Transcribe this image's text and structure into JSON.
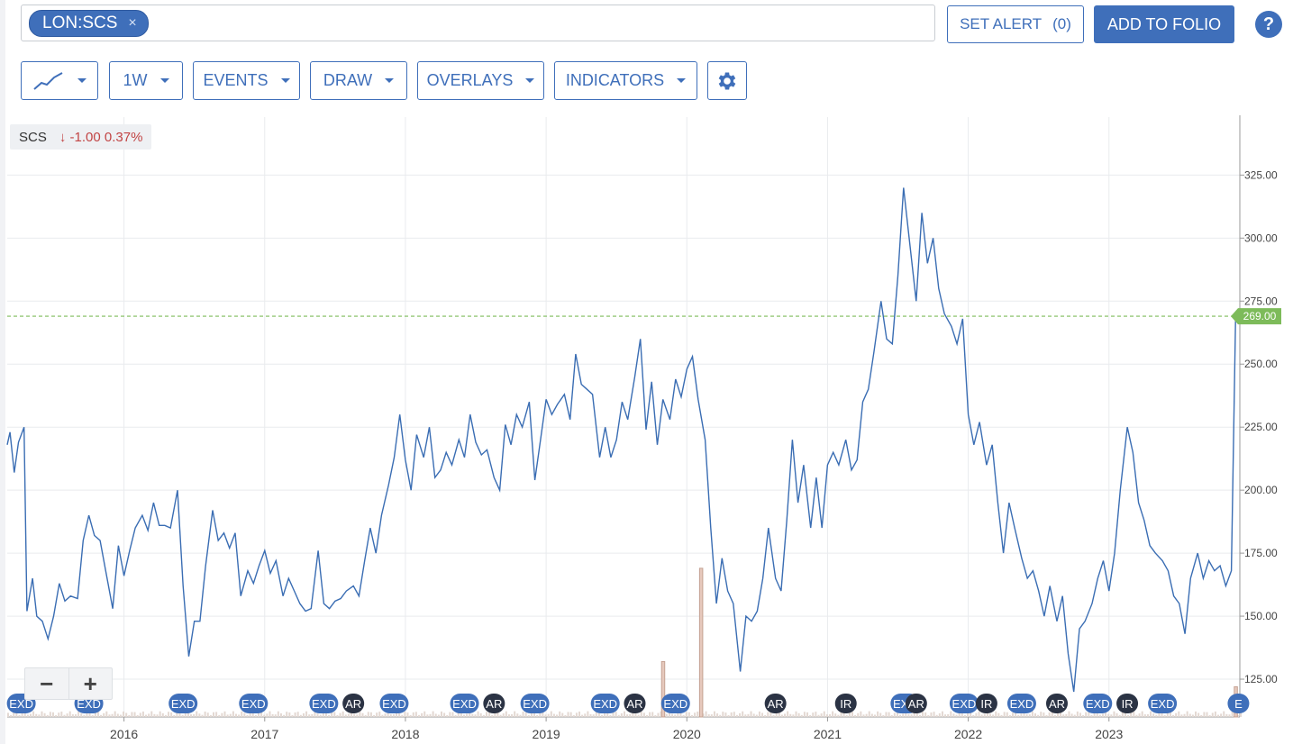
{
  "search": {
    "chip_label": "LON:SCS",
    "chip_close": "×"
  },
  "header": {
    "set_alert_label": "SET ALERT",
    "set_alert_count": "(0)",
    "add_to_folio_label": "ADD TO FOLIO",
    "help_label": "?"
  },
  "toolbar": {
    "period_label": "1W",
    "events_label": "EVENTS",
    "draw_label": "DRAW",
    "overlays_label": "OVERLAYS",
    "indicators_label": "INDICATORS"
  },
  "legend": {
    "symbol": "SCS",
    "arrow": "↓",
    "change": "-1.00 0.37%"
  },
  "zoom": {
    "minus": "−",
    "plus": "+"
  },
  "colors": {
    "accent": "#3f6fba",
    "line": "#3a6db3",
    "last_price": "#7dbb5a",
    "negative": "#c24545"
  },
  "chart_data": {
    "type": "line",
    "series_name": "SCS",
    "interval": "1W",
    "y_ticks": [
      125,
      150,
      175,
      200,
      225,
      250,
      275,
      300,
      325
    ],
    "y_tick_labels": [
      "125.00",
      "150.00",
      "175.00",
      "200.00",
      "225.00",
      "250.00",
      "275.00",
      "300.00",
      "325.00"
    ],
    "ylim": [
      110,
      348
    ],
    "xlim": [
      2015.17,
      2023.93
    ],
    "x_ticks": [
      2016,
      2017,
      2018,
      2019,
      2020,
      2021,
      2022,
      2023
    ],
    "x_tick_labels": [
      "2016",
      "2017",
      "2018",
      "2019",
      "2020",
      "2021",
      "2022",
      "2023"
    ],
    "last_price": 269.0,
    "last_price_label": "269.00",
    "points": [
      [
        2015.17,
        218
      ],
      [
        2015.19,
        223
      ],
      [
        2015.22,
        207
      ],
      [
        2015.25,
        219
      ],
      [
        2015.29,
        225
      ],
      [
        2015.31,
        152
      ],
      [
        2015.35,
        165
      ],
      [
        2015.38,
        150
      ],
      [
        2015.42,
        148
      ],
      [
        2015.46,
        141
      ],
      [
        2015.5,
        150
      ],
      [
        2015.54,
        163
      ],
      [
        2015.58,
        156
      ],
      [
        2015.62,
        158
      ],
      [
        2015.67,
        157
      ],
      [
        2015.71,
        180
      ],
      [
        2015.75,
        190
      ],
      [
        2015.79,
        182
      ],
      [
        2015.83,
        180
      ],
      [
        2015.87,
        168
      ],
      [
        2015.92,
        153
      ],
      [
        2015.96,
        178
      ],
      [
        2016.0,
        166
      ],
      [
        2016.04,
        176
      ],
      [
        2016.08,
        185
      ],
      [
        2016.13,
        190
      ],
      [
        2016.17,
        184
      ],
      [
        2016.21,
        195
      ],
      [
        2016.25,
        186
      ],
      [
        2016.29,
        186
      ],
      [
        2016.33,
        185
      ],
      [
        2016.38,
        200
      ],
      [
        2016.42,
        162
      ],
      [
        2016.46,
        134
      ],
      [
        2016.5,
        148
      ],
      [
        2016.54,
        148
      ],
      [
        2016.58,
        170
      ],
      [
        2016.63,
        192
      ],
      [
        2016.67,
        180
      ],
      [
        2016.71,
        183
      ],
      [
        2016.75,
        177
      ],
      [
        2016.79,
        183
      ],
      [
        2016.83,
        158
      ],
      [
        2016.88,
        168
      ],
      [
        2016.92,
        163
      ],
      [
        2016.96,
        170
      ],
      [
        2017.0,
        176
      ],
      [
        2017.04,
        167
      ],
      [
        2017.08,
        172
      ],
      [
        2017.13,
        158
      ],
      [
        2017.17,
        165
      ],
      [
        2017.21,
        160
      ],
      [
        2017.25,
        155
      ],
      [
        2017.29,
        152
      ],
      [
        2017.33,
        153
      ],
      [
        2017.38,
        176
      ],
      [
        2017.42,
        155
      ],
      [
        2017.46,
        153
      ],
      [
        2017.5,
        156
      ],
      [
        2017.54,
        157
      ],
      [
        2017.58,
        160
      ],
      [
        2017.63,
        162
      ],
      [
        2017.67,
        158
      ],
      [
        2017.71,
        172
      ],
      [
        2017.75,
        185
      ],
      [
        2017.79,
        175
      ],
      [
        2017.83,
        190
      ],
      [
        2017.88,
        202
      ],
      [
        2017.92,
        213
      ],
      [
        2017.96,
        230
      ],
      [
        2018.0,
        212
      ],
      [
        2018.04,
        200
      ],
      [
        2018.08,
        222
      ],
      [
        2018.13,
        213
      ],
      [
        2018.17,
        225
      ],
      [
        2018.21,
        205
      ],
      [
        2018.25,
        208
      ],
      [
        2018.29,
        215
      ],
      [
        2018.33,
        210
      ],
      [
        2018.38,
        220
      ],
      [
        2018.42,
        213
      ],
      [
        2018.46,
        230
      ],
      [
        2018.5,
        219
      ],
      [
        2018.54,
        214
      ],
      [
        2018.58,
        216
      ],
      [
        2018.63,
        205
      ],
      [
        2018.67,
        200
      ],
      [
        2018.71,
        226
      ],
      [
        2018.75,
        218
      ],
      [
        2018.79,
        230
      ],
      [
        2018.83,
        225
      ],
      [
        2018.88,
        235
      ],
      [
        2018.92,
        204
      ],
      [
        2018.96,
        220
      ],
      [
        2019.0,
        236
      ],
      [
        2019.04,
        230
      ],
      [
        2019.08,
        234
      ],
      [
        2019.13,
        238
      ],
      [
        2019.17,
        228
      ],
      [
        2019.21,
        254
      ],
      [
        2019.25,
        242
      ],
      [
        2019.29,
        240
      ],
      [
        2019.33,
        238
      ],
      [
        2019.38,
        213
      ],
      [
        2019.42,
        225
      ],
      [
        2019.46,
        213
      ],
      [
        2019.5,
        220
      ],
      [
        2019.54,
        235
      ],
      [
        2019.58,
        228
      ],
      [
        2019.63,
        245
      ],
      [
        2019.67,
        260
      ],
      [
        2019.71,
        224
      ],
      [
        2019.75,
        243
      ],
      [
        2019.79,
        218
      ],
      [
        2019.83,
        236
      ],
      [
        2019.88,
        228
      ],
      [
        2019.92,
        244
      ],
      [
        2019.96,
        237
      ],
      [
        2020.0,
        248
      ],
      [
        2020.04,
        253
      ],
      [
        2020.08,
        236
      ],
      [
        2020.13,
        220
      ],
      [
        2020.17,
        185
      ],
      [
        2020.21,
        155
      ],
      [
        2020.25,
        173
      ],
      [
        2020.29,
        160
      ],
      [
        2020.33,
        155
      ],
      [
        2020.38,
        128
      ],
      [
        2020.42,
        150
      ],
      [
        2020.46,
        148
      ],
      [
        2020.5,
        152
      ],
      [
        2020.54,
        165
      ],
      [
        2020.58,
        185
      ],
      [
        2020.63,
        165
      ],
      [
        2020.67,
        160
      ],
      [
        2020.71,
        188
      ],
      [
        2020.75,
        220
      ],
      [
        2020.79,
        195
      ],
      [
        2020.83,
        210
      ],
      [
        2020.88,
        185
      ],
      [
        2020.92,
        205
      ],
      [
        2020.96,
        185
      ],
      [
        2021.0,
        210
      ],
      [
        2021.04,
        215
      ],
      [
        2021.08,
        210
      ],
      [
        2021.13,
        220
      ],
      [
        2021.17,
        208
      ],
      [
        2021.21,
        212
      ],
      [
        2021.25,
        235
      ],
      [
        2021.29,
        240
      ],
      [
        2021.33,
        255
      ],
      [
        2021.38,
        275
      ],
      [
        2021.42,
        260
      ],
      [
        2021.46,
        258
      ],
      [
        2021.5,
        285
      ],
      [
        2021.54,
        320
      ],
      [
        2021.58,
        300
      ],
      [
        2021.63,
        275
      ],
      [
        2021.67,
        310
      ],
      [
        2021.71,
        290
      ],
      [
        2021.75,
        300
      ],
      [
        2021.79,
        280
      ],
      [
        2021.83,
        270
      ],
      [
        2021.88,
        265
      ],
      [
        2021.92,
        258
      ],
      [
        2021.96,
        268
      ],
      [
        2022.0,
        230
      ],
      [
        2022.04,
        218
      ],
      [
        2022.08,
        227
      ],
      [
        2022.13,
        210
      ],
      [
        2022.17,
        218
      ],
      [
        2022.21,
        195
      ],
      [
        2022.25,
        175
      ],
      [
        2022.29,
        195
      ],
      [
        2022.33,
        185
      ],
      [
        2022.38,
        173
      ],
      [
        2022.42,
        165
      ],
      [
        2022.46,
        168
      ],
      [
        2022.5,
        160
      ],
      [
        2022.54,
        150
      ],
      [
        2022.58,
        162
      ],
      [
        2022.63,
        148
      ],
      [
        2022.67,
        158
      ],
      [
        2022.71,
        135
      ],
      [
        2022.75,
        120
      ],
      [
        2022.79,
        145
      ],
      [
        2022.83,
        148
      ],
      [
        2022.88,
        155
      ],
      [
        2022.92,
        165
      ],
      [
        2022.96,
        172
      ],
      [
        2023.0,
        160
      ],
      [
        2023.04,
        175
      ],
      [
        2023.08,
        200
      ],
      [
        2023.13,
        225
      ],
      [
        2023.17,
        215
      ],
      [
        2023.21,
        195
      ],
      [
        2023.25,
        188
      ],
      [
        2023.29,
        178
      ],
      [
        2023.33,
        175
      ],
      [
        2023.38,
        172
      ],
      [
        2023.42,
        168
      ],
      [
        2023.46,
        158
      ],
      [
        2023.5,
        155
      ],
      [
        2023.54,
        143
      ],
      [
        2023.58,
        165
      ],
      [
        2023.63,
        175
      ],
      [
        2023.67,
        165
      ],
      [
        2023.71,
        172
      ],
      [
        2023.75,
        168
      ],
      [
        2023.79,
        170
      ],
      [
        2023.83,
        162
      ],
      [
        2023.87,
        168
      ],
      [
        2023.9,
        269
      ]
    ],
    "volume_spikes": [
      [
        2019.83,
        132
      ],
      [
        2020.1,
        169
      ],
      [
        2023.9,
        122
      ]
    ],
    "events": [
      {
        "x": 2015.27,
        "label": "EXD"
      },
      {
        "x": 2015.75,
        "label": "EXD"
      },
      {
        "x": 2016.42,
        "label": "EXD"
      },
      {
        "x": 2016.92,
        "label": "EXD"
      },
      {
        "x": 2017.42,
        "label": "EXD"
      },
      {
        "x": 2017.63,
        "label": "AR"
      },
      {
        "x": 2017.92,
        "label": "EXD"
      },
      {
        "x": 2018.42,
        "label": "EXD"
      },
      {
        "x": 2018.63,
        "label": "AR"
      },
      {
        "x": 2018.92,
        "label": "EXD"
      },
      {
        "x": 2019.42,
        "label": "EXD"
      },
      {
        "x": 2019.63,
        "label": "AR"
      },
      {
        "x": 2019.92,
        "label": "EXD"
      },
      {
        "x": 2020.63,
        "label": "AR"
      },
      {
        "x": 2021.13,
        "label": "IR"
      },
      {
        "x": 2021.55,
        "label": "EXD"
      },
      {
        "x": 2021.63,
        "label": "AR"
      },
      {
        "x": 2021.97,
        "label": "EXD"
      },
      {
        "x": 2022.13,
        "label": "IR"
      },
      {
        "x": 2022.38,
        "label": "EXD"
      },
      {
        "x": 2022.63,
        "label": "AR"
      },
      {
        "x": 2022.92,
        "label": "EXD"
      },
      {
        "x": 2023.13,
        "label": "IR"
      },
      {
        "x": 2023.38,
        "label": "EXD"
      },
      {
        "x": 2023.92,
        "label": "E"
      }
    ]
  }
}
